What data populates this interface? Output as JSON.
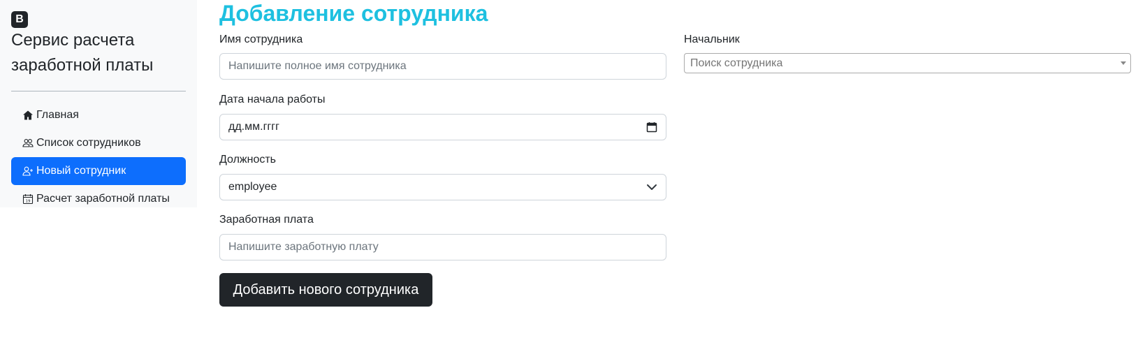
{
  "sidebar": {
    "brand_logo": "B",
    "brand_title": "Сервис расчета заработной платы",
    "items": [
      {
        "label": "Главная",
        "icon": "house-icon",
        "active": false
      },
      {
        "label": "Список сотрудников",
        "icon": "people-icon",
        "active": false
      },
      {
        "label": "Новый сотрудник",
        "icon": "person-add-icon",
        "active": true
      },
      {
        "label": "Расчет заработной платы",
        "icon": "calendar-icon",
        "active": false
      }
    ]
  },
  "main": {
    "title": "Добавление сотрудника",
    "name_field": {
      "label": "Имя сотрудника",
      "placeholder": "Напишите полное имя сотрудника",
      "value": ""
    },
    "start_date_field": {
      "label": "Дата начала работы",
      "value": "дд.мм.гггг"
    },
    "position_field": {
      "label": "Должность",
      "value": "employee"
    },
    "salary_field": {
      "label": "Заработная плата",
      "placeholder": "Напишите заработную плату",
      "value": ""
    },
    "manager_field": {
      "label": "Начальник",
      "placeholder": "Поиск сотрудника"
    },
    "submit_label": "Добавить нового сотрудника"
  },
  "colors": {
    "accent": "#0d6efd",
    "title": "#1ec0e0",
    "dark_button": "#212529"
  }
}
